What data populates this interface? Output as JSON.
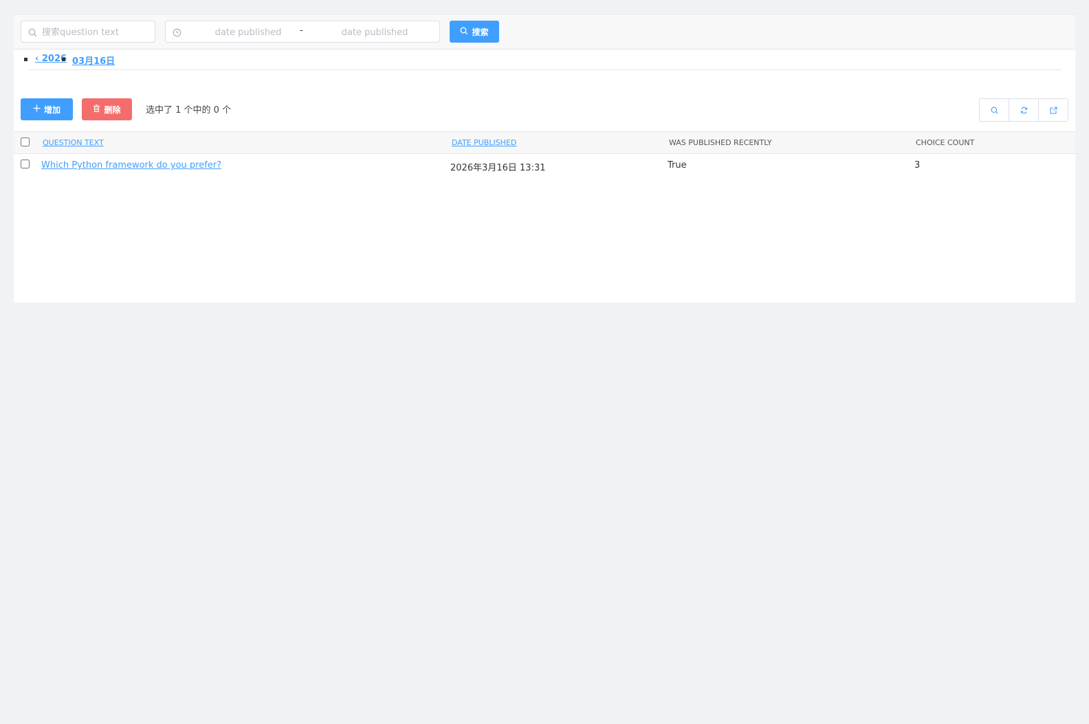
{
  "filters": {
    "search_placeholder": "搜索question text",
    "date_start_placeholder": "date published",
    "date_end_placeholder": "date published",
    "date_separator": "-",
    "search_button": "搜索"
  },
  "breadcrumb": {
    "year": "‹ 2026",
    "day": "03月16日"
  },
  "actions": {
    "add_label": "增加",
    "delete_label": "删除",
    "selection_count": "选中了 1 个中的 0 个"
  },
  "toolbar": {
    "icons": [
      "search-icon",
      "refresh-icon",
      "export-icon"
    ]
  },
  "table": {
    "columns": [
      "QUESTION TEXT",
      "DATE PUBLISHED",
      "WAS PUBLISHED RECENTLY",
      "CHOICE COUNT"
    ],
    "rows": [
      {
        "question_text": "Which Python framework do you prefer?",
        "date_published": "2026年3月16日 13:31",
        "was_published_recently": "True",
        "choice_count": "3"
      }
    ]
  },
  "colors": {
    "primary": "#409eff",
    "danger": "#f56c6c",
    "page_bg": "#f0f3f6"
  }
}
